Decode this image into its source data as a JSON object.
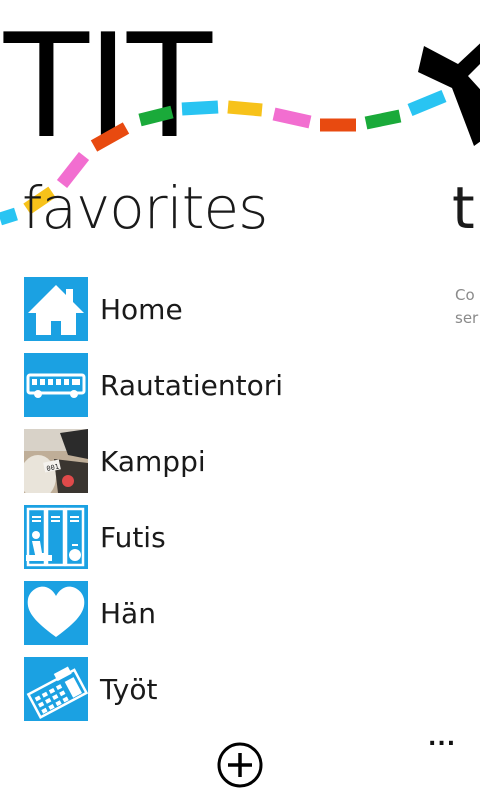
{
  "app": {
    "title": "TIT"
  },
  "pivot": {
    "current_header": "favorites",
    "next_header": "t",
    "next_preview_lines": [
      "Co",
      "ser"
    ]
  },
  "favorites": [
    {
      "label": "Home",
      "icon": "home-icon"
    },
    {
      "label": "Rautatientori",
      "icon": "bus-icon"
    },
    {
      "label": "Kamppi",
      "icon": "photo-thumbnail"
    },
    {
      "label": "Futis",
      "icon": "locker-room-icon"
    },
    {
      "label": "Hän",
      "icon": "heart-icon"
    },
    {
      "label": "Työt",
      "icon": "calculator-icon"
    }
  ],
  "appbar": {
    "add_icon": "add-icon",
    "more_label": "..."
  },
  "colors": {
    "tile": "#1ba1e2",
    "route_cyan": "#29c4f2",
    "route_orange": "#e84a10",
    "route_green": "#1aaa3a",
    "route_yellow": "#f7c21a",
    "route_pink": "#f26ed0"
  }
}
